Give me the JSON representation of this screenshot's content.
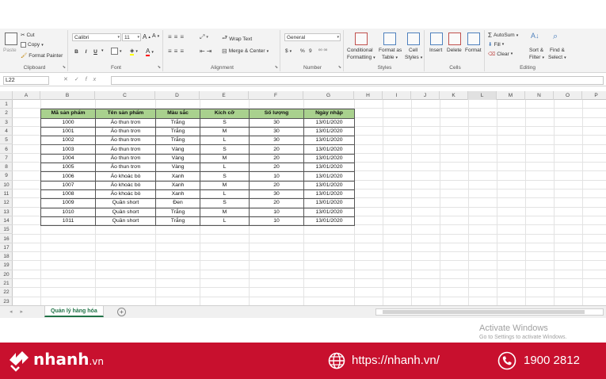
{
  "ribbon": {
    "clipboard": {
      "label": "Clipboard",
      "paste": "Paste",
      "cut": "Cut",
      "copy": "Copy",
      "format_painter": "Format Painter"
    },
    "font": {
      "label": "Font",
      "name": "Calibri",
      "size": "11",
      "bold": "B",
      "italic": "I",
      "underline": "U"
    },
    "alignment": {
      "label": "Alignment",
      "wrap_text": "Wrap Text",
      "merge_center": "Merge & Center"
    },
    "number": {
      "label": "Number",
      "format": "General",
      "currency": "$",
      "percent": "%",
      "comma": "9"
    },
    "styles": {
      "label": "Styles",
      "conditional": "Conditional",
      "conditional2": "Formatting",
      "format_as": "Format as",
      "format_as2": "Table",
      "cell": "Cell",
      "cell2": "Styles"
    },
    "cells": {
      "label": "Cells",
      "insert": "Insert",
      "delete": "Delete",
      "format": "Format"
    },
    "editing": {
      "label": "Editing",
      "autosum": "AutoSum",
      "fill": "Fill",
      "clear": "Clear",
      "sort": "Sort &",
      "sort2": "Filter",
      "find": "Find &",
      "find2": "Select"
    }
  },
  "formula_bar": {
    "name_box": "L22",
    "formula": ""
  },
  "columns": [
    "A",
    "B",
    "C",
    "D",
    "E",
    "F",
    "G",
    "H",
    "I",
    "J",
    "K",
    "L",
    "M",
    "N",
    "O",
    "P"
  ],
  "rows": [
    "1",
    "2",
    "3",
    "4",
    "5",
    "6",
    "7",
    "8",
    "9",
    "10",
    "11",
    "12",
    "13",
    "14",
    "15",
    "16",
    "17",
    "18",
    "19",
    "20",
    "21",
    "22",
    "23"
  ],
  "table": {
    "headers": [
      "Mã sản phẩm",
      "Tên sản phẩm",
      "Màu sắc",
      "Kích cỡ",
      "Số lượng",
      "Ngày nhập"
    ],
    "rows": [
      [
        "1000",
        "Áo thun trơn",
        "Trắng",
        "S",
        "30",
        "13/01/2020"
      ],
      [
        "1001",
        "Áo thun trơn",
        "Trắng",
        "M",
        "30",
        "13/01/2020"
      ],
      [
        "1002",
        "Áo thun trơn",
        "Trắng",
        "L",
        "30",
        "13/01/2020"
      ],
      [
        "1003",
        "Áo thun trơn",
        "Vàng",
        "S",
        "20",
        "13/01/2020"
      ],
      [
        "1004",
        "Áo thun trơn",
        "Vàng",
        "M",
        "20",
        "13/01/2020"
      ],
      [
        "1005",
        "Áo thun trơn",
        "Vàng",
        "L",
        "20",
        "13/01/2020"
      ],
      [
        "1006",
        "Áo khoác bò",
        "Xanh",
        "S",
        "10",
        "13/01/2020"
      ],
      [
        "1007",
        "Áo khoác bò",
        "Xanh",
        "M",
        "20",
        "13/01/2020"
      ],
      [
        "1008",
        "Áo khoác bò",
        "Xanh",
        "L",
        "30",
        "13/01/2020"
      ],
      [
        "1009",
        "Quần short",
        "Đen",
        "S",
        "20",
        "13/01/2020"
      ],
      [
        "1010",
        "Quần short",
        "Trắng",
        "M",
        "10",
        "13/01/2020"
      ],
      [
        "1011",
        "Quần short",
        "Trắng",
        "L",
        "10",
        "13/01/2020"
      ]
    ]
  },
  "sheet_tab": "Quản lý hàng hóa",
  "watermark": {
    "line1": "Activate Windows",
    "line2": "Go to Settings to activate Windows."
  },
  "footer": {
    "brand": "nhanh",
    "brand_suffix": ".vn",
    "website": "https://nhanh.vn/",
    "phone": "1900 2812",
    "background": "#c8102e"
  },
  "colors": {
    "header_fill": "#a9d18e",
    "excel_green": "#217346"
  }
}
